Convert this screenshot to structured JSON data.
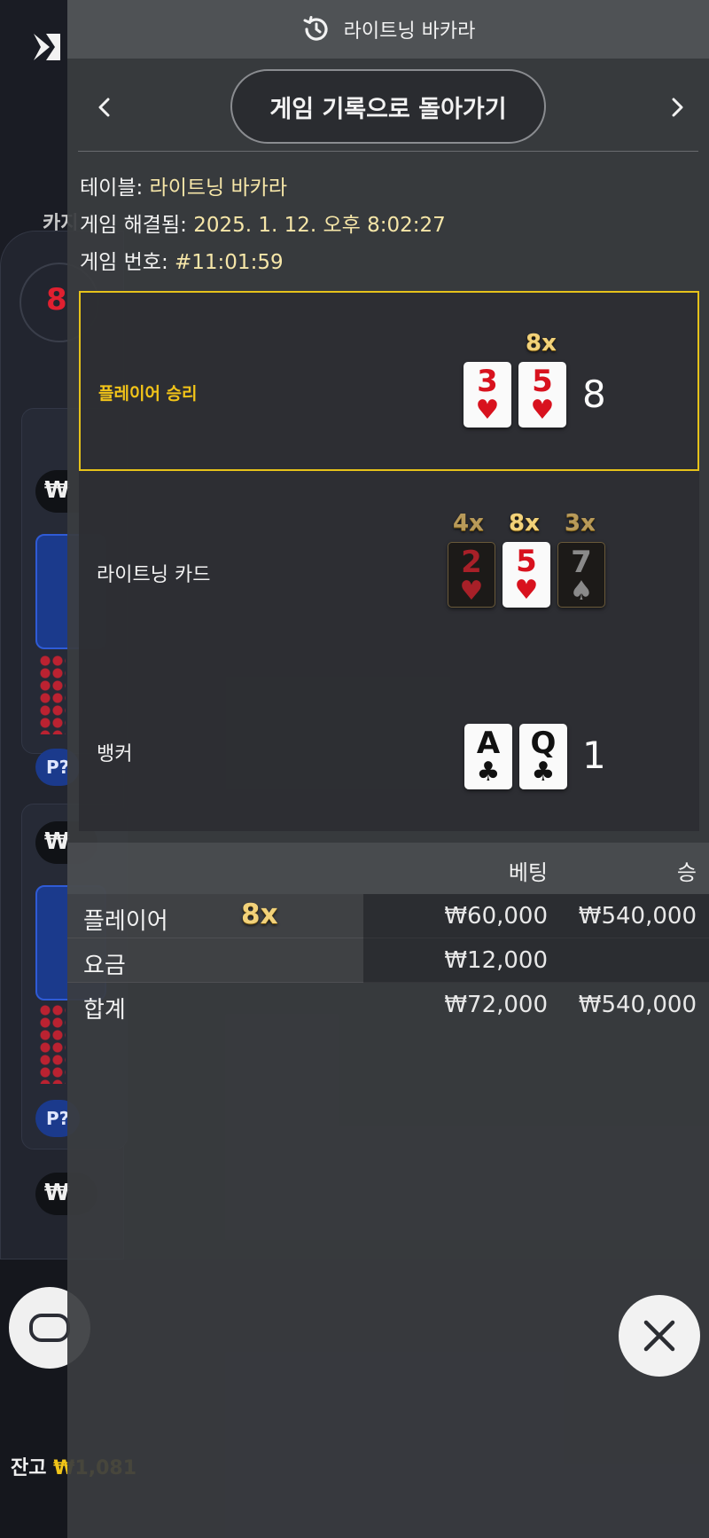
{
  "background": {
    "category_label": "카지",
    "card_price_1": "₩",
    "card_price_2": "₩",
    "card_price_3": "₩",
    "pq_label": "P?",
    "balance_label": "잔고",
    "balance_value": "₩1,081"
  },
  "panel": {
    "header_title": "라이트닝 바카라",
    "back_button_label": "게임 기록으로 돌아가기",
    "info": {
      "table_label": "테이블:",
      "table_value": "라이트닝 바카라",
      "resolved_label": "게임 해결됨:",
      "resolved_value": "2025. 1. 12. 오후 8:02:27",
      "round_label": "게임 번호:",
      "round_value": "#11:01:59"
    },
    "player_section": {
      "label": "플레이어 승리",
      "multiplier": "8x",
      "cards": [
        {
          "rank": "3",
          "suit": "♥"
        },
        {
          "rank": "5",
          "suit": "♥"
        }
      ],
      "score": "8"
    },
    "lightning_section": {
      "label": "라이트닝 카드",
      "cards": [
        {
          "rank": "2",
          "suit": "♥",
          "multiplier": "4x"
        },
        {
          "rank": "5",
          "suit": "♥",
          "multiplier": "8x"
        },
        {
          "rank": "7",
          "suit": "♠",
          "multiplier": "3x"
        }
      ]
    },
    "banker_section": {
      "label": "뱅커",
      "cards": [
        {
          "rank": "A",
          "suit": "♣"
        },
        {
          "rank": "Q",
          "suit": "♣"
        }
      ],
      "score": "1"
    },
    "bets_table": {
      "headers": {
        "bet": "베팅",
        "win": "승"
      },
      "rows": [
        {
          "name": "플레이어",
          "multiplier": "8x",
          "bet": "₩60,000",
          "win": "₩540,000"
        },
        {
          "name": "요금",
          "bet": "₩12,000",
          "win": ""
        }
      ],
      "total": {
        "name": "합계",
        "bet": "₩72,000",
        "win": "₩540,000"
      }
    }
  },
  "icons": {
    "history": "history-icon",
    "prev": "chevron-left-icon",
    "next": "chevron-right-icon",
    "close": "close-icon",
    "chip": "chip-stack-icon"
  },
  "colors": {
    "accent_gold": "#e6c21a",
    "card_red": "#d8121e",
    "balance_yellow": "#f0c419"
  }
}
